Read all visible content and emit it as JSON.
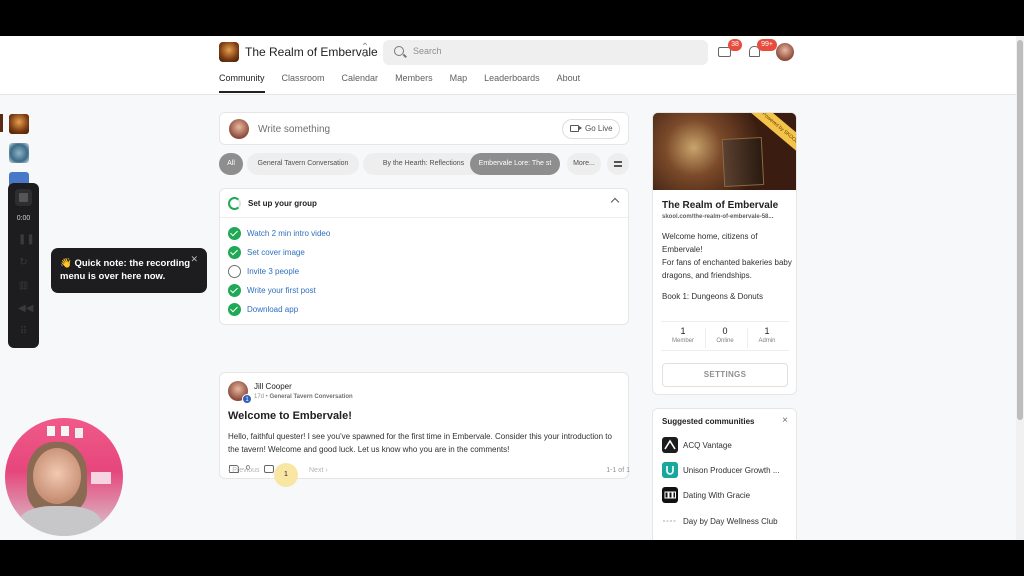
{
  "header": {
    "group_name": "The Realm of Embervale",
    "search_placeholder": "Search",
    "chat_badge": "38",
    "notif_badge": "99+"
  },
  "nav": [
    "Community",
    "Classroom",
    "Calendar",
    "Members",
    "Map",
    "Leaderboards",
    "About"
  ],
  "composer": {
    "placeholder": "Write something",
    "go_live": "Go Live"
  },
  "filters": {
    "all": "All",
    "chips": [
      "General Tavern Conversation",
      "By the Hearth: Reflections",
      "Embervale Lore: The st"
    ],
    "more": "More..."
  },
  "setup": {
    "title": "Set up your group",
    "tasks": [
      {
        "label": "Watch 2 min intro video",
        "done": true
      },
      {
        "label": "Set cover image",
        "done": true
      },
      {
        "label": "Invite 3 people",
        "done": false
      },
      {
        "label": "Write your first post",
        "done": true
      },
      {
        "label": "Download app",
        "done": true
      }
    ]
  },
  "post": {
    "author": "Jill Cooper",
    "level": "1",
    "age": "17d",
    "category": "General Tavern Conversation",
    "title": "Welcome to Embervale!",
    "body": "Hello, faithful quester! I see you've spawned for the first time in Embervale. Consider this your introduction to the tavern! Welcome and good luck. Let us know who you are in the comments!",
    "likes": "0",
    "comments": "0"
  },
  "pagination": {
    "prev": "Previous",
    "page": "1",
    "next": "Next",
    "range": "1-1 of 1"
  },
  "about": {
    "cover_badge": "Powered by SKOOL",
    "name": "The Realm of Embervale",
    "url": "skool.com/the-realm-of-embervale-58...",
    "description": "Welcome home, citizens of Embervale!\nFor fans of enchanted bakeries baby dragons, and friendships.",
    "book": "Book 1: Dungeons & Donuts",
    "stats": [
      {
        "num": "1",
        "label": "Member"
      },
      {
        "num": "0",
        "label": "Online"
      },
      {
        "num": "1",
        "label": "Admin"
      }
    ],
    "settings": "SETTINGS"
  },
  "suggested": {
    "title": "Suggested communities",
    "items": [
      {
        "label": "ACQ Vantage",
        "icon_color": "#1c1c1c"
      },
      {
        "label": "Unison Producer Growth ...",
        "icon_color": "#17a79c"
      },
      {
        "label": "Dating With Gracie",
        "icon_color": "#111111"
      },
      {
        "label": "Day by Day Wellness Club",
        "icon_color": "#ffffff"
      }
    ]
  },
  "recorder": {
    "time": "0:00"
  },
  "tooltip": {
    "text": "👋 Quick note: the recording menu is over here now."
  },
  "colors": {
    "accent_green": "#1fa855",
    "link_blue": "#2e6fc0",
    "badge_red": "#e74c3c",
    "pagination_active": "#f9e6a3"
  }
}
